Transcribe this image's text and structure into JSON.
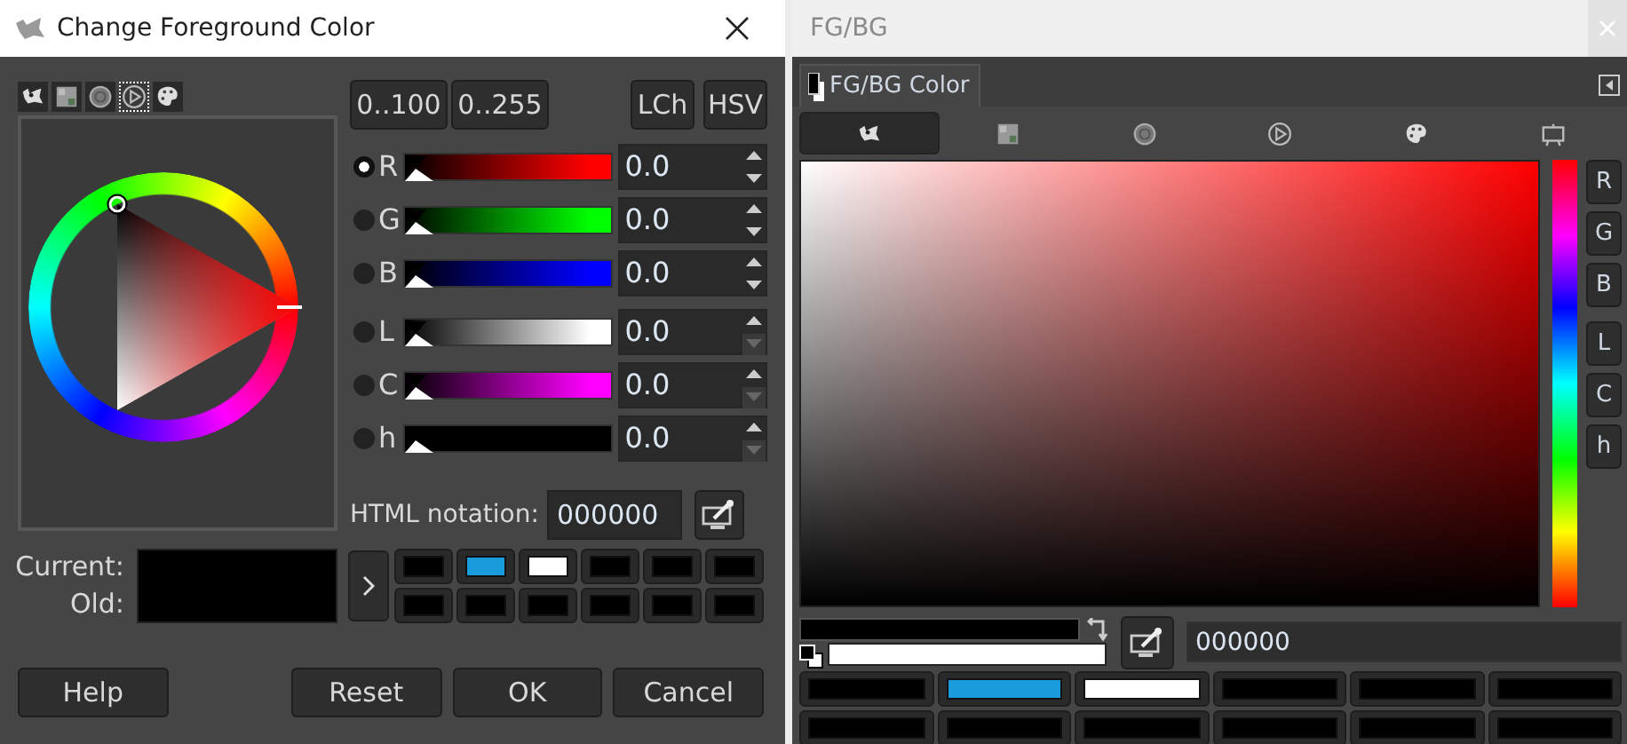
{
  "dialog": {
    "title": "Change Foreground Color"
  },
  "selector_tabs": [
    {
      "selected": false
    },
    {
      "selected": false
    },
    {
      "selected": false
    },
    {
      "selected": true
    },
    {
      "selected": false
    }
  ],
  "range_buttons": [
    "0..100",
    "0..255"
  ],
  "model_buttons": [
    "LCh",
    "HSV"
  ],
  "channels": [
    {
      "label": "R",
      "selected": true,
      "color": "#ff0000",
      "level": 0,
      "value": "0.0",
      "down_disabled": false
    },
    {
      "label": "G",
      "selected": false,
      "color": "#00ff00",
      "level": 0,
      "value": "0.0",
      "down_disabled": false
    },
    {
      "label": "B",
      "selected": false,
      "color": "#0000ff",
      "level": 0,
      "value": "0.0",
      "down_disabled": false
    },
    {
      "label": "L",
      "selected": false,
      "color": "#ffffff",
      "level": 0,
      "value": "0.0",
      "down_disabled": true
    },
    {
      "label": "C",
      "selected": false,
      "color": "#ff00ff",
      "level": 0,
      "value": "0.0",
      "down_disabled": true
    },
    {
      "label": "h",
      "selected": false,
      "color": "#000000",
      "level": 0,
      "value": "0.0",
      "down_disabled": true
    }
  ],
  "html_notation": {
    "label": "HTML notation:",
    "value": "000000"
  },
  "current_label": "Current:",
  "old_label": "Old:",
  "history": [
    {
      "color": "#000000"
    },
    {
      "color": "#1a9cdc"
    },
    {
      "color": "#ffffff"
    },
    {
      "color": "#000000"
    },
    {
      "color": "#000000"
    },
    {
      "color": "#000000"
    },
    {
      "color": "#000000"
    },
    {
      "color": "#000000"
    },
    {
      "color": "#000000"
    },
    {
      "color": "#000000"
    },
    {
      "color": "#000000"
    },
    {
      "color": "#000000"
    }
  ],
  "buttons": [
    "Help",
    "Reset",
    "OK",
    "Cancel"
  ],
  "panel": {
    "title": "FG/BG",
    "tab": "FG/BG Color",
    "selector_tabs": [
      {
        "selected": true
      },
      {
        "selected": false
      },
      {
        "selected": false
      },
      {
        "selected": false
      },
      {
        "selected": false
      },
      {
        "selected": false
      }
    ],
    "channel_buttons": [
      "R",
      "G",
      "B",
      "L",
      "C",
      "h"
    ],
    "swatches": [
      {
        "kind": "foreground",
        "color": "#000000"
      },
      {
        "kind": "background",
        "color": "#ffffff"
      }
    ],
    "hex_value": "000000",
    "history": [
      {
        "color": "#000000"
      },
      {
        "color": "#1a9cdc"
      },
      {
        "color": "#ffffff"
      },
      {
        "color": "#000000"
      },
      {
        "color": "#000000"
      },
      {
        "color": "#000000"
      },
      {
        "color": "#000000"
      },
      {
        "color": "#000000"
      },
      {
        "color": "#000000"
      },
      {
        "color": "#000000"
      },
      {
        "color": "#000000"
      },
      {
        "color": "#000000"
      }
    ]
  }
}
